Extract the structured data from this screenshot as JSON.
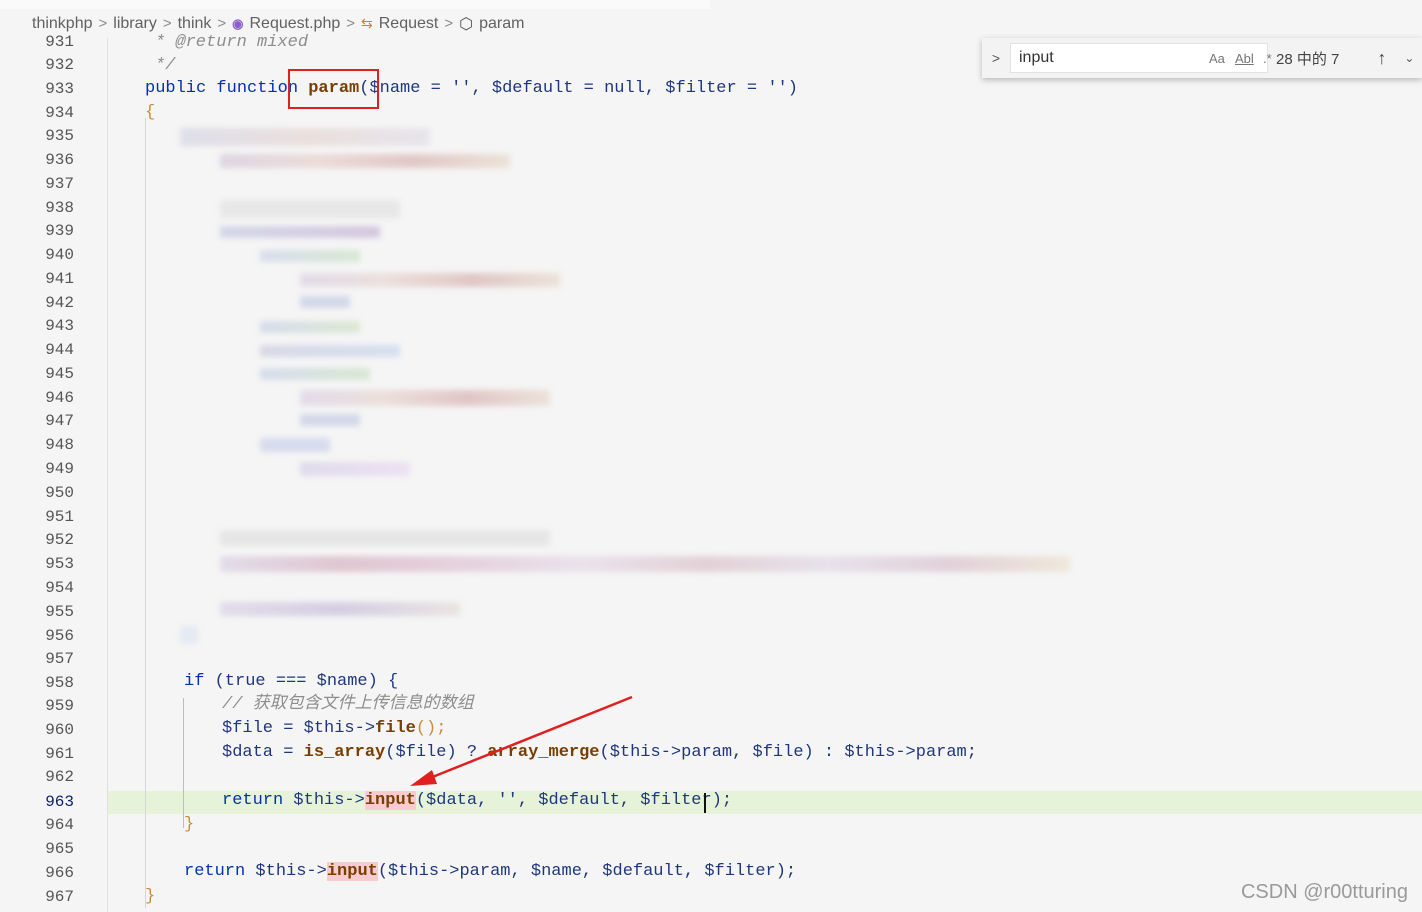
{
  "breadcrumb": {
    "items": [
      "thinkphp",
      "library",
      "think",
      "Request.php",
      "Request",
      "param"
    ]
  },
  "find_widget": {
    "query": "input",
    "match_case_label": "Aa",
    "whole_word_label": "Abl",
    "regex_label": ".*",
    "count": "28 中的 7"
  },
  "editor": {
    "line_numbers": [
      "931",
      "932",
      "933",
      "934",
      "935",
      "936",
      "937",
      "938",
      "939",
      "940",
      "941",
      "942",
      "943",
      "944",
      "945",
      "946",
      "947",
      "948",
      "949",
      "950",
      "951",
      "952",
      "953",
      "954",
      "955",
      "956",
      "957",
      "958",
      "959",
      "960",
      "961",
      "962",
      "963",
      "964",
      "965",
      "966",
      "967"
    ],
    "active_line": "963",
    "lines": {
      "l931": "* @return mixed",
      "l932": "*/",
      "l933_kw": "public function ",
      "l933_fn": "param",
      "l933_rest": "($name = '', $default = null, $filter = '')",
      "l934": "{",
      "l958_if": "if ",
      "l958_rest": "(true === $name) {",
      "l959": "// 获取包含文件上传信息的数组",
      "l960_a": "$file = $this->",
      "l960_fn": "file",
      "l960_b": "();",
      "l961_a": "$data = ",
      "l961_fn1": "is_array",
      "l961_b": "($file) ? ",
      "l961_fn2": "array_merge",
      "l961_c": "($this->param, $file) : $this->param;",
      "l963_kw": "return ",
      "l963_a": "$this->",
      "l963_fn": "input",
      "l963_b": "($data, '', $default, $filter);",
      "l964": "}",
      "l966_kw": "return ",
      "l966_a": "$this->",
      "l966_fn": "input",
      "l966_b": "($this->param, $name, $default, $filter);",
      "l967": "}"
    }
  },
  "watermark": "CSDN @r00tturing",
  "colors": {
    "annotation_red": "#e02020",
    "match_highlight": "#f8cbd0",
    "current_line": "#e6f3d8"
  }
}
